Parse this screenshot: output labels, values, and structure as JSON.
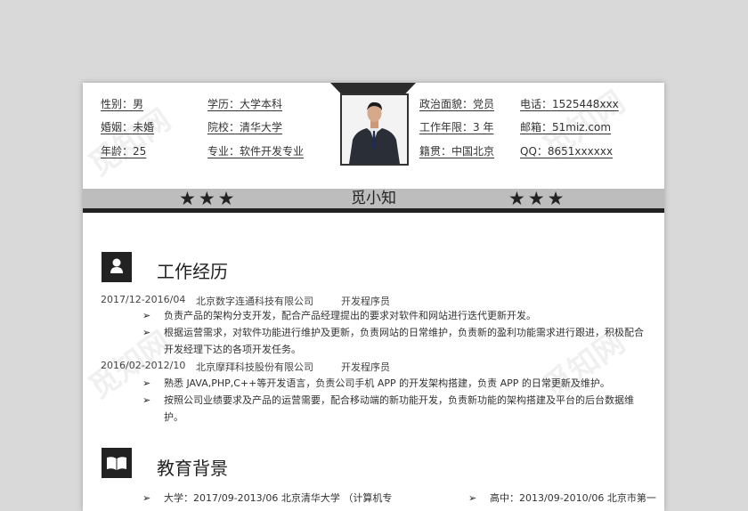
{
  "header": {
    "left": [
      "性别：男",
      "婚姻：未婚",
      "年龄：25"
    ],
    "mid": [
      "学历：大学本科",
      "院校：清华大学",
      "专业：软件开发专业"
    ],
    "right1": [
      "政治面貌：党员",
      "工作年限：3 年",
      "籍贯：中国北京"
    ],
    "right2": [
      "电话：1525448xxx",
      "邮箱：51miz.com",
      "QQ：8651xxxxxx"
    ]
  },
  "name": "觅小知",
  "stars": "★★★",
  "work": {
    "title": "工作经历",
    "jobs": [
      {
        "date": "2017/12-2016/04",
        "company": "北京数字连通科技有限公司",
        "role": "开发程序员",
        "bullets": [
          "负责产品的架构分支开发，配合产品经理提出的要求对软件和网站进行迭代更新开发。",
          "根据运营需求，对软件功能进行维护及更新，负责网站的日常维护，负责新的盈利功能需求进行跟进，积极配合开发经理下达的各项开发任务。"
        ]
      },
      {
        "date": "2016/02-2012/10",
        "company": "北京摩拜科技股份有限公司",
        "role": "开发程序员",
        "bullets": [
          "熟悉 JAVA,PHP,C++等开发语言，负责公司手机 APP 的开发架构搭建，负责 APP 的日常更新及维护。",
          "按照公司业绩要求及产品的运营需要，配合移动端的新功能开发，负责新功能的架构搭建及平台的后台数据维护。"
        ]
      }
    ]
  },
  "education": {
    "title": "教育背景",
    "items": [
      "大学：2017/09-2013/06    北京清华大学  （计算机专",
      "高中：2013/09-2010/06    北京市第一"
    ]
  },
  "watermark": "觅知网"
}
